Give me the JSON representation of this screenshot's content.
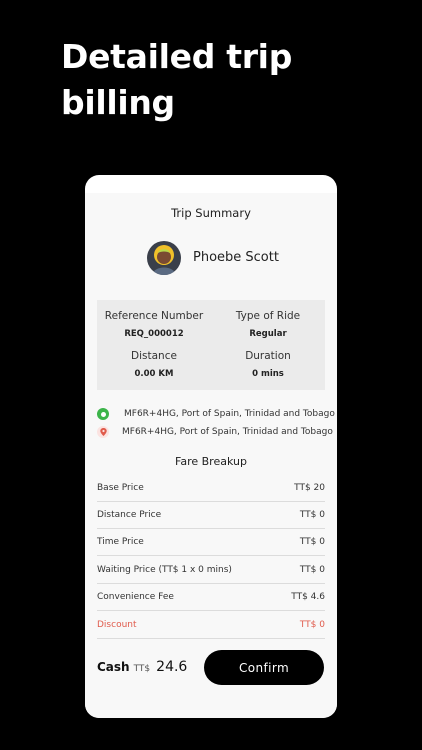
{
  "headline": {
    "line1": "Detailed trip",
    "line2": "billing"
  },
  "trip": {
    "title": "Trip Summary",
    "rider_name": "Phoebe Scott",
    "reference_label": "Reference Number",
    "reference_value": "REQ_000012",
    "ride_type_label": "Type of Ride",
    "ride_type_value": "Regular",
    "distance_label": "Distance",
    "distance_value": "0.00 KM",
    "duration_label": "Duration",
    "duration_value": "0 mins",
    "pickup": "MF6R+4HG, Port of Spain, Trinidad and Tobago",
    "dropoff": "MF6R+4HG, Port of Spain, Trinidad and Tobago"
  },
  "fare": {
    "title": "Fare Breakup",
    "rows": [
      {
        "label": "Base Price",
        "value": "TT$ 20"
      },
      {
        "label": "Distance Price",
        "value": "TT$ 0"
      },
      {
        "label": "Time Price",
        "value": "TT$ 0"
      },
      {
        "label": "Waiting Price (TT$ 1 x 0 mins)",
        "value": "TT$ 0"
      },
      {
        "label": "Convenience Fee",
        "value": "TT$ 4.6"
      },
      {
        "label": "Discount",
        "value": "TT$ 0"
      }
    ]
  },
  "footer": {
    "payment_method": "Cash",
    "currency": "TT$",
    "total": "24.6",
    "confirm_label": "Confirm"
  },
  "colors": {
    "background": "#000000",
    "pickup_green": "#3cb44a",
    "discount_red": "#e05b4c"
  }
}
